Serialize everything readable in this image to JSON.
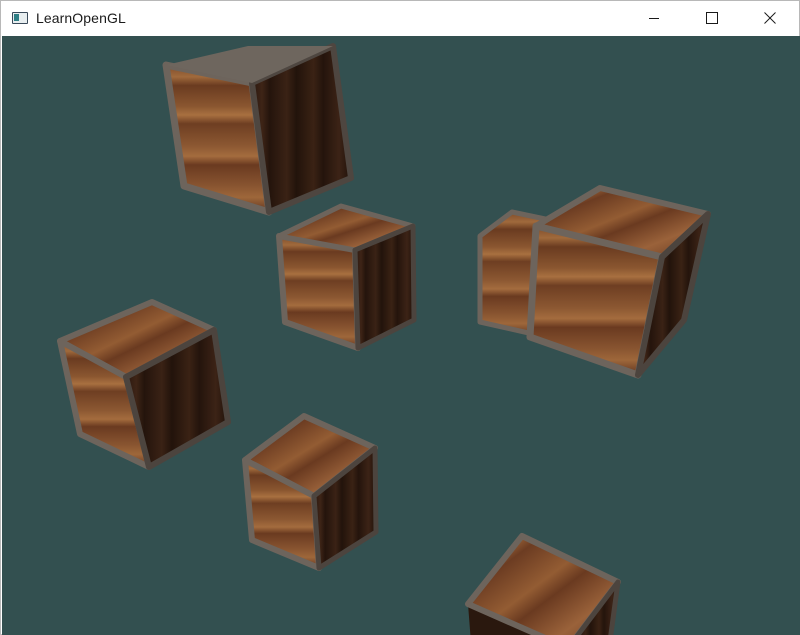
{
  "window": {
    "title": "LearnOpenGL",
    "icon": "app-window-icon"
  },
  "caption_buttons": {
    "minimize": "minimize-icon",
    "maximize": "maximize-icon",
    "close": "close-icon"
  },
  "scene": {
    "clear_color": "#335050",
    "crate_count": 8,
    "crate_texture": "wooden-crate",
    "colors": {
      "wood_light": "#7a4a2c",
      "wood_mid": "#5e3620",
      "wood_dark": "#2e1a10",
      "frame_metal": "#6e6660"
    }
  }
}
